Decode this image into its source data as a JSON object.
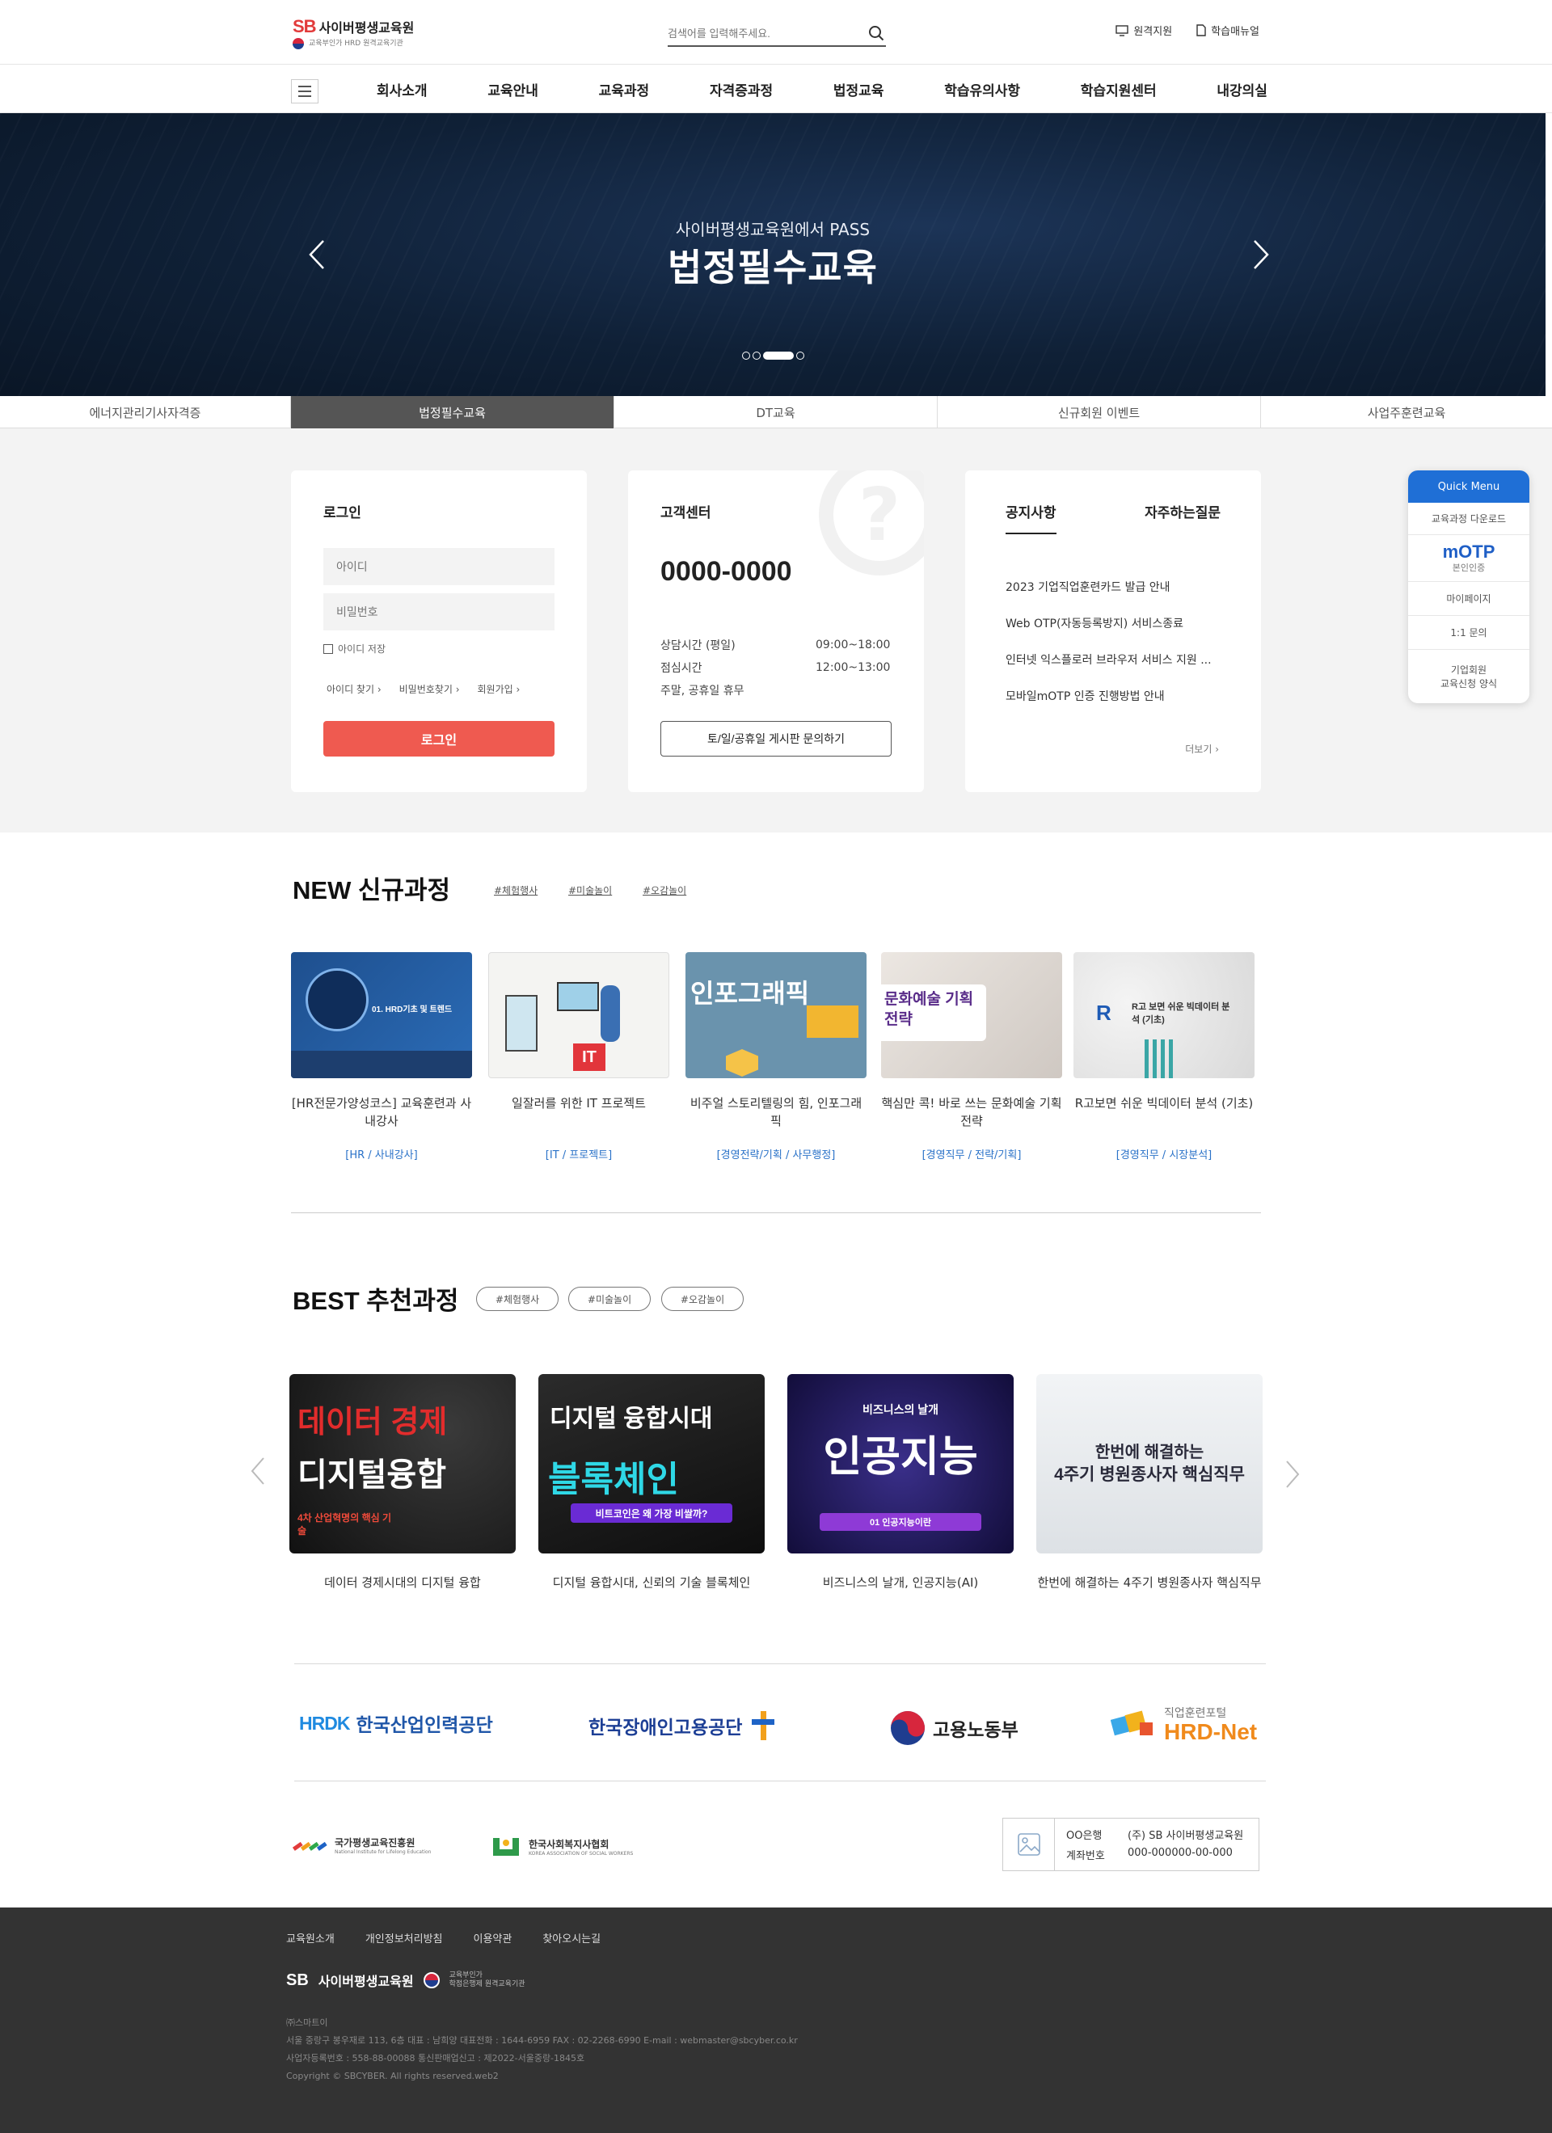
{
  "header": {
    "logo_sb": "SB",
    "logo_name": "사이버평생교육원",
    "logo_sub": "교육부인가 HRD 원격교육기관",
    "search_placeholder": "검색어를 입력해주세요.",
    "links": [
      "원격지원",
      "학습매뉴얼"
    ]
  },
  "gnb": {
    "items": [
      "회사소개",
      "교육안내",
      "교육과정",
      "자격증과정",
      "법정교육",
      "학습유의사항",
      "학습지원센터",
      "내강의실"
    ]
  },
  "hero": {
    "subtitle": "사이버평생교육원에서 PASS",
    "title": "법정필수교육",
    "slide_index": 3,
    "slide_count": 4
  },
  "tabs": {
    "items": [
      "에너지관리기사자격증",
      "법정필수교육",
      "DT교육",
      "신규회원 이벤트",
      "사업주훈련교육"
    ],
    "active": 1
  },
  "login": {
    "title": "로그인",
    "id_placeholder": "아이디",
    "pw_placeholder": "비밀번호",
    "save_id": "아이디 저장",
    "find_id": "아이디 찾기",
    "find_pw": "비밀번호찾기",
    "join": "회원가입",
    "button": "로그인"
  },
  "customer_center": {
    "title": "고객센터",
    "phone": "0000-0000",
    "rows": [
      {
        "label": "상담시간 (평일)",
        "value": "09:00~18:00"
      },
      {
        "label": "점심시간",
        "value": "12:00~13:00"
      },
      {
        "label": "주말, 공휴일 휴무",
        "value": ""
      }
    ],
    "board_button": "토/일/공휴일 게시판 문의하기"
  },
  "notice": {
    "tab_notice": "공지사항",
    "tab_faq": "자주하는질문",
    "items": [
      "2023 기업직업훈련카드 발급 안내",
      "Web OTP(자동등록방지) 서비스종료",
      "인터넷 익스플로러 브라우저 서비스 지원 ...",
      "모바일mOTP 인증 진행방법 안내"
    ],
    "more": "더보기"
  },
  "quick_menu": {
    "title": "Quick Menu",
    "download": "교육과정 다운로드",
    "otp_title": "mOTP",
    "otp_sub": "본인인증",
    "mypage": "마이페이지",
    "inquiry": "1:1 문의",
    "corp_line1": "기업회원",
    "corp_line2": "교육신청 양식"
  },
  "new_courses": {
    "title": "NEW 신규과정",
    "tags": [
      "#체험행사",
      "#미술놀이",
      "#오감놀이"
    ],
    "items": [
      {
        "name": "[HR전문가양성코스] 교육훈련과 사내강사",
        "category": "[HR / 사내강사]",
        "thumb_text": "01. HRD기초 및 트렌드"
      },
      {
        "name": "일잘러를 위한 IT 프로젝트",
        "category": "[IT / 프로젝트]",
        "thumb_text": "IT"
      },
      {
        "name": "비주얼 스토리텔링의 힘, 인포그래픽",
        "category": "[경영전략/기획 / 사무행정]",
        "thumb_text": "인포그래픽"
      },
      {
        "name": "핵심만 콕! 바로 쓰는 문화예술 기획전략",
        "category": "[경영직무 / 전략/기획]",
        "thumb_text": "문화예술 기획전략"
      },
      {
        "name": "R고보면 쉬운 빅데이터 분석 (기초)",
        "category": "[경영직무 / 시장분석]",
        "thumb_text": "R고 보면 쉬운 빅데이터 분석 (기초)"
      }
    ]
  },
  "best_courses": {
    "title": "BEST 추천과정",
    "tags": [
      "#체험행사",
      "#미술놀이",
      "#오감놀이"
    ],
    "items": [
      {
        "name": "데이터 경제시대의 디지털 융합",
        "thumb_l1": "데이터 경제",
        "thumb_l2": "디지털융합",
        "thumb_l3": "4차 산업혁명의 핵심 기술"
      },
      {
        "name": "디지털 융합시대, 신뢰의 기술 블록체인",
        "thumb_l1": "디지털 융합시대",
        "thumb_l2": "블록체인",
        "thumb_l3": "비트코인은 왜 가장 비쌀까?"
      },
      {
        "name": "비즈니스의 날개, 인공지능(AI)",
        "thumb_l1": "비즈니스의 날개",
        "thumb_l2": "인공지능",
        "thumb_l3": "01 인공지능이란"
      },
      {
        "name": "한번에 해결하는 4주기 병원종사자 핵심직무",
        "thumb_l1": "한번에 해결하는",
        "thumb_l2": "4주기 병원종사자 핵심직무",
        "thumb_l3": ""
      }
    ]
  },
  "partners": {
    "items": [
      {
        "mark": "HRDK",
        "name": "한국산업인력공단"
      },
      {
        "mark": "",
        "name": "한국장애인고용공단"
      },
      {
        "mark": "",
        "name": "고용노동부"
      },
      {
        "mark": "직업훈련포털",
        "name": "HRD-Net"
      }
    ]
  },
  "sub_partners": {
    "items": [
      {
        "name": "국가평생교육진흥원",
        "sub": "National Institute for Lifelong Education"
      },
      {
        "name": "한국사회복지사협회",
        "sub": "KOREA ASSOCIATION OF SOCIAL WORKERS"
      }
    ]
  },
  "bank": {
    "bank_name": "OO은행",
    "holder": "(주) SB 사이버평생교육원",
    "account_label": "계좌번호",
    "account_no": "000-000000-00-000"
  },
  "footer": {
    "links": [
      "교육원소개",
      "개인정보처리방침",
      "이용약관",
      "찾아오시는길"
    ],
    "logo_sb": "SB",
    "logo_name": "사이버평생교육원",
    "logo_sub1": "교육부인가",
    "logo_sub2": "학점은행제 원격교육기관",
    "company": "㈜스마트이",
    "address": "서울 중랑구 봉우재로 113, 6층 대표 : 남희양 대표전화 : 1644-6959 FAX : 02-2268-6990 E-mail : webmaster@sbcyber.co.kr",
    "biz": "사업자등록번호 : 558-88-00088 통신판매업신고 : 제2022-서울중랑-1845호",
    "copyright": "Copyright © SBCYBER. All rights reserved.web2"
  },
  "colors": {
    "accent_red": "#ef5a50",
    "link_blue": "#2a72c8",
    "quick_blue": "#1f6fd6",
    "hero_navy": "#0f2036",
    "footer_bg": "#333333"
  }
}
